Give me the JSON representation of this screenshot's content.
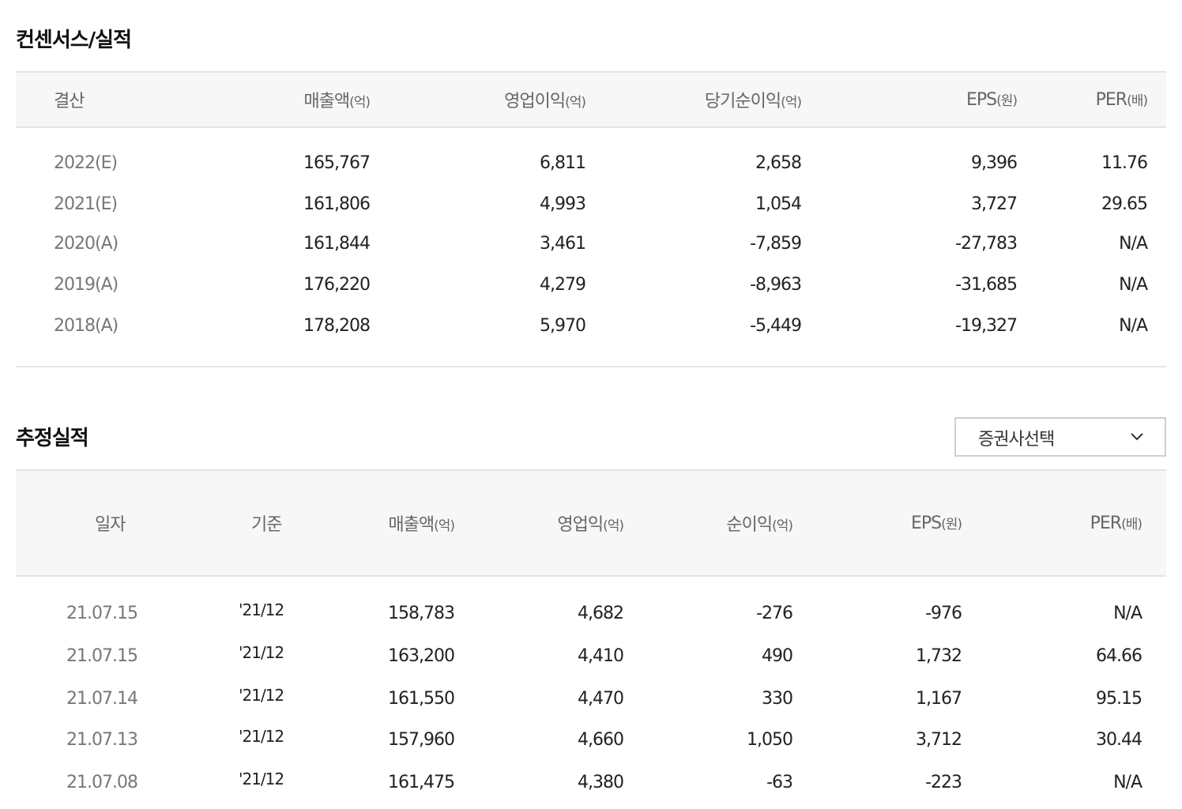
{
  "consensus": {
    "title": "컨센서스/실적",
    "headers": [
      {
        "label": "결산",
        "unit": ""
      },
      {
        "label": "매출액",
        "unit": "(억)"
      },
      {
        "label": "영업이익",
        "unit": "(억)"
      },
      {
        "label": "당기순이익",
        "unit": "(억)"
      },
      {
        "label": "EPS",
        "unit": "(원)"
      },
      {
        "label": "PER",
        "unit": "(배)"
      }
    ],
    "rows": [
      [
        "2022(E)",
        "165,767",
        "6,811",
        "2,658",
        "9,396",
        "11.76"
      ],
      [
        "2021(E)",
        "161,806",
        "4,993",
        "1,054",
        "3,727",
        "29.65"
      ],
      [
        "2020(A)",
        "161,844",
        "3,461",
        "-7,859",
        "-27,783",
        "N/A"
      ],
      [
        "2019(A)",
        "176,220",
        "4,279",
        "-8,963",
        "-31,685",
        "N/A"
      ],
      [
        "2018(A)",
        "178,208",
        "5,970",
        "-5,449",
        "-19,327",
        "N/A"
      ]
    ]
  },
  "estimates": {
    "title": "추정실적",
    "broker_select": {
      "label": "증권사선택",
      "icon": "chevron-down-icon"
    },
    "headers": [
      {
        "label": "일자",
        "unit": ""
      },
      {
        "label": "기준",
        "unit": ""
      },
      {
        "label": "매출액",
        "unit": "(억)"
      },
      {
        "label": "영업익",
        "unit": "(억)"
      },
      {
        "label": "순이익",
        "unit": "(억)"
      },
      {
        "label": "EPS",
        "unit": "(원)"
      },
      {
        "label": "PER",
        "unit": "(배)"
      }
    ],
    "rows": [
      [
        "21.07.15",
        "'21/12",
        "158,783",
        "4,682",
        "-276",
        "-976",
        "N/A"
      ],
      [
        "21.07.15",
        "'21/12",
        "163,200",
        "4,410",
        "490",
        "1,732",
        "64.66"
      ],
      [
        "21.07.14",
        "'21/12",
        "161,550",
        "4,470",
        "330",
        "1,167",
        "95.15"
      ],
      [
        "21.07.13",
        "'21/12",
        "157,960",
        "4,660",
        "1,050",
        "3,712",
        "30.44"
      ],
      [
        "21.07.08",
        "'21/12",
        "161,475",
        "4,380",
        "-63",
        "-223",
        "N/A"
      ]
    ]
  }
}
